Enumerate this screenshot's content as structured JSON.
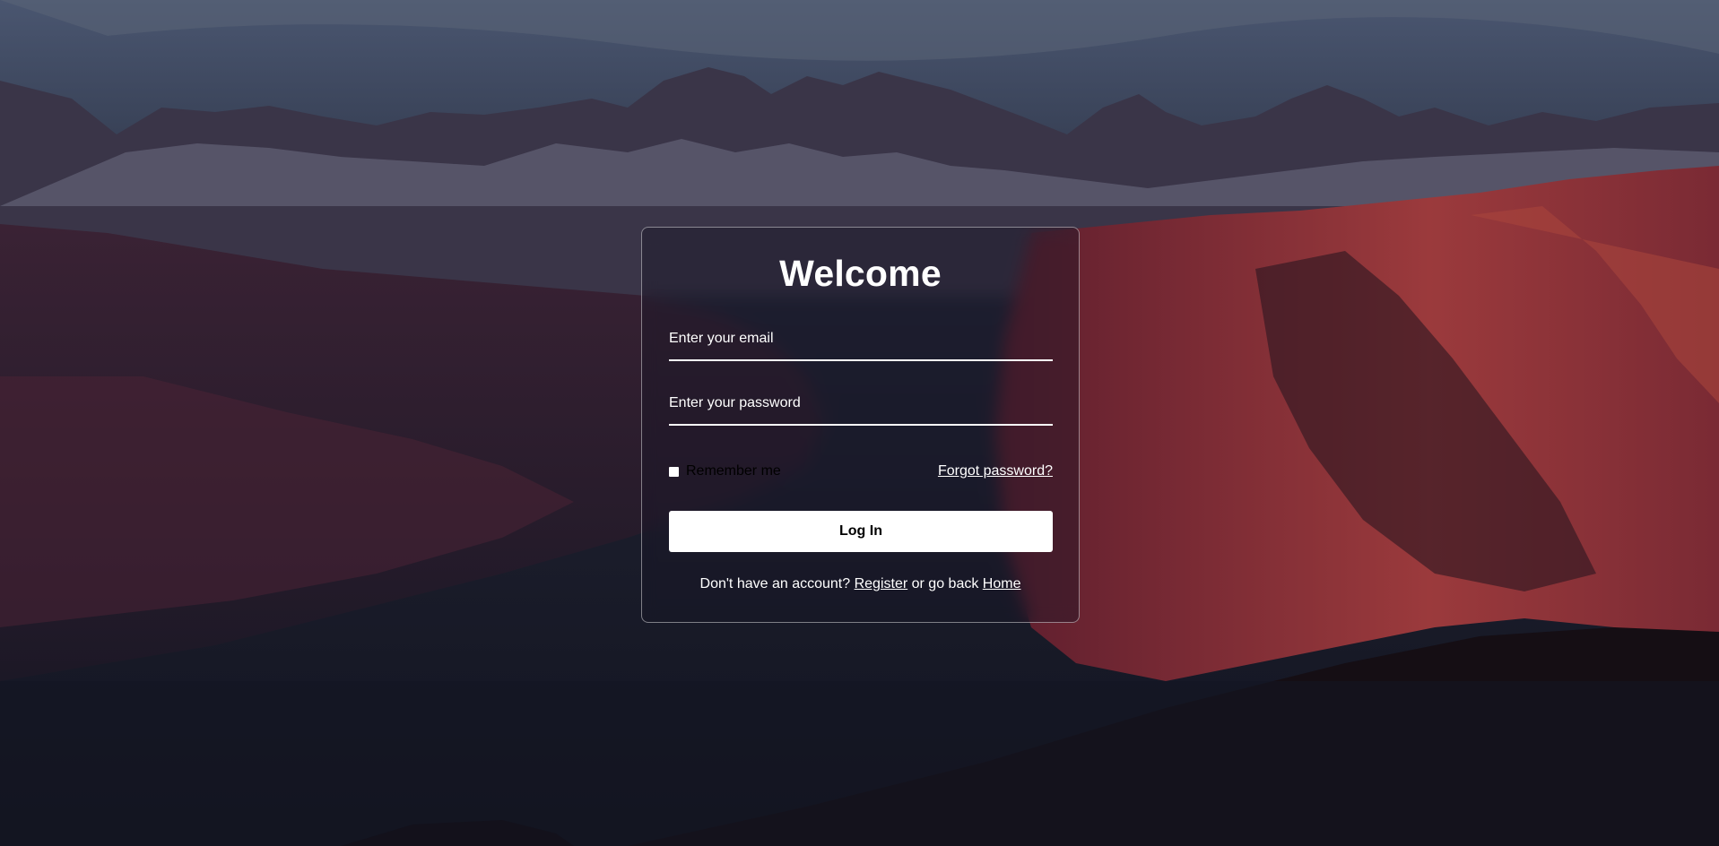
{
  "login": {
    "title": "Welcome",
    "email_placeholder": "Enter your email",
    "password_placeholder": "Enter your password",
    "remember_label": "Remember me",
    "forgot_link": "Forgot password?",
    "login_button": "Log In",
    "register_prefix": "Don't have an account?",
    "register_link": "Register",
    "home_prefix": "or go back",
    "home_link": "Home"
  },
  "colors": {
    "card_border": "#ffffff",
    "button_bg": "#ffffff",
    "button_text": "#000000",
    "text": "#ffffff"
  }
}
